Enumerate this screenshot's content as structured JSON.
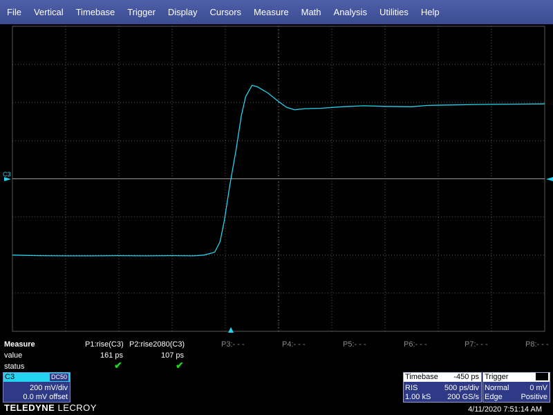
{
  "menu": [
    "File",
    "Vertical",
    "Timebase",
    "Trigger",
    "Display",
    "Cursors",
    "Measure",
    "Math",
    "Analysis",
    "Utilities",
    "Help"
  ],
  "channel_marker": "C3",
  "trace_color": "#23d4f0",
  "measure": {
    "title": "Measure",
    "row_labels": {
      "value": "value",
      "status": "status"
    },
    "params": [
      {
        "name": "P1:rise(C3)",
        "value": "161 ps",
        "status": "ok"
      },
      {
        "name": "P2:rise2080(C3)",
        "value": "107 ps",
        "status": "ok"
      }
    ],
    "empty_params": [
      "P3:- - -",
      "P4:- - -",
      "P5:- - -",
      "P6:- - -",
      "P7:- - -",
      "P8:- - -"
    ]
  },
  "channel": {
    "name": "C3",
    "coupling": "DC50",
    "scale": "200 mV/div",
    "offset": "0.0 mV offset"
  },
  "timebase": {
    "title": "Timebase",
    "delay": "-450 ps",
    "mode": "RIS",
    "per_div": "500 ps/div",
    "samples": "1.00 kS",
    "rate": "200 GS/s"
  },
  "trigger": {
    "title": "Trigger",
    "source": "C3",
    "mode": "Normal",
    "level": "0 mV",
    "type": "Edge",
    "slope": "Positive"
  },
  "brand": {
    "bold": "TELEDYNE",
    "light": "LECROY"
  },
  "datetime": "4/11/2020 7:51:14 AM",
  "waveform_mv": [
    [
      0,
      -400
    ],
    [
      0.5,
      -403
    ],
    [
      1,
      -404
    ],
    [
      1.5,
      -404
    ],
    [
      2,
      -403
    ],
    [
      2.5,
      -404
    ],
    [
      3,
      -403
    ],
    [
      3.4,
      -404
    ],
    [
      3.6,
      -400
    ],
    [
      3.8,
      -385
    ],
    [
      3.9,
      -330
    ],
    [
      3.98,
      -220
    ],
    [
      4.08,
      -40
    ],
    [
      4.2,
      150
    ],
    [
      4.3,
      330
    ],
    [
      4.38,
      430
    ],
    [
      4.5,
      490
    ],
    [
      4.6,
      483
    ],
    [
      4.8,
      450
    ],
    [
      5,
      405
    ],
    [
      5.15,
      375
    ],
    [
      5.3,
      362
    ],
    [
      5.5,
      368
    ],
    [
      5.8,
      370
    ],
    [
      6.2,
      378
    ],
    [
      6.6,
      383
    ],
    [
      7,
      380
    ],
    [
      7.5,
      378
    ],
    [
      7.8,
      385
    ],
    [
      8.2,
      387
    ],
    [
      8.8,
      390
    ],
    [
      9.5,
      392
    ],
    [
      10,
      393
    ]
  ]
}
